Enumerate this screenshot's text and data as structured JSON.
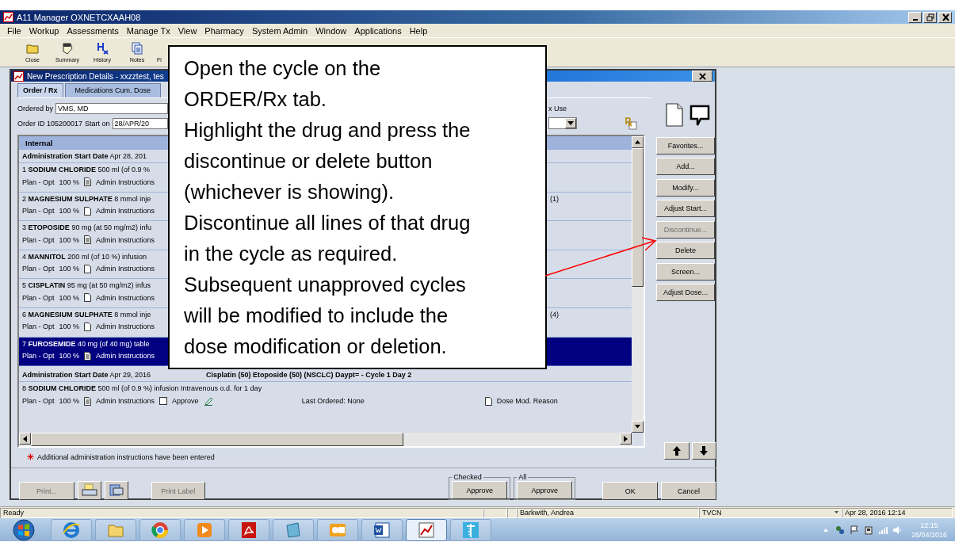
{
  "app": {
    "title": "A11 Manager OXNETCXAAH08"
  },
  "menu": [
    "File",
    "Workup",
    "Assessments",
    "Manage Tx",
    "View",
    "Pharmacy",
    "System Admin",
    "Window",
    "Applications",
    "Help"
  ],
  "toolbar": [
    {
      "label": "Close",
      "kind": "folder"
    },
    {
      "label": "Summary",
      "kind": "note"
    },
    {
      "label": "History",
      "kind": "history"
    },
    {
      "label": "Notes",
      "kind": "pages"
    },
    {
      "label": "Fl",
      "kind": "none"
    }
  ],
  "dialog": {
    "title": "New Prescription Details - xxzztest, tes",
    "tabs": [
      {
        "label": "Order / Rx",
        "selected": true
      },
      {
        "label": "Medications Cum. Dose",
        "selected": false
      }
    ],
    "ordered_by_label": "Ordered by",
    "ordered_by": "VMS,  MD",
    "order_id": "Order ID 105200017",
    "start_on_label": "Start on",
    "start_on": "28/APR/20",
    "use_label": "x Use",
    "list_header": "Internal",
    "groups": [
      {
        "label": "Administration Start Date",
        "date": "Apr 28, 201",
        "rows": [
          {
            "num": "1",
            "name": "SODIUM CHLORIDE",
            "detail": "500 ml (of 0.9 %",
            "plan": "Plan - Opt",
            "percent": "100 %",
            "instructions": true,
            "admin": "Admin Instructions",
            "selected": false
          },
          {
            "num": "2",
            "name": "MAGNESIUM SULPHATE",
            "detail": "8 mmol inje",
            "plan": "Plan - Opt",
            "percent": "100 %",
            "instructions": false,
            "admin": "Admin Instructions",
            "note": "(1)",
            "selected": false
          },
          {
            "num": "3",
            "name": "ETOPOSIDE",
            "detail": "90 mg (at 50 mg/m2) infu",
            "plan": "Plan - Opt",
            "percent": "100 %",
            "instructions": true,
            "admin": "Admin Instructions",
            "selected": false
          },
          {
            "num": "4",
            "name": "MANNITOL",
            "detail": "200 ml (of 10 %) infusion",
            "plan": "Plan - Opt",
            "percent": "100 %",
            "instructions": false,
            "admin": "Admin Instructions",
            "selected": false
          },
          {
            "num": "5",
            "name": "CISPLATIN",
            "detail": "95 mg (at 50 mg/m2) infus",
            "plan": "Plan - Opt",
            "percent": "100 %",
            "instructions": false,
            "admin": "Admin Instructions",
            "selected": false
          },
          {
            "num": "6",
            "name": "MAGNESIUM SULPHATE",
            "detail": "8 mmol inje",
            "plan": "Plan - Opt",
            "percent": "100 %",
            "instructions": false,
            "admin": "Admin Instructions",
            "note": "(4)",
            "selected": false
          },
          {
            "num": "7",
            "name": "FUROSEMIDE",
            "detail": "40 mg (of 40 mg) table",
            "plan": "Plan - Opt",
            "percent": "100 %",
            "instructions": true,
            "admin": "Admin Instructions",
            "selected": true
          }
        ]
      },
      {
        "label": "Administration Start Date",
        "date": "Apr 29, 2016",
        "regimen": "Cisplatin (50) Etoposide (50) (NSCLC) Daypt= - Cycle 1 Day 2",
        "rows": [
          {
            "num": "8",
            "name": "SODIUM CHLORIDE",
            "detail": "500 ml (of 0.9 %) infusion Intravenous o.d. for 1 day",
            "plan": "Plan - Opt",
            "percent": "100 %",
            "instructions": true,
            "admin": "Admin Instructions",
            "selected": false,
            "approve": {
              "label": "Approve",
              "checked": false
            },
            "last_ordered": "Last Ordered: None",
            "dose_mod": "Dose Mod. Reason"
          }
        ]
      }
    ],
    "side_buttons": [
      {
        "label": "Favorites...",
        "disabled": false
      },
      {
        "label": "Add...",
        "disabled": false
      },
      {
        "label": "Modify...",
        "disabled": false
      },
      {
        "label": "Adjust Start...",
        "disabled": false
      },
      {
        "label": "Discontinue...",
        "disabled": true
      },
      {
        "label": "Delete",
        "disabled": false
      },
      {
        "label": "Screen...",
        "disabled": false
      },
      {
        "label": "Adjust Dose...",
        "disabled": false
      }
    ],
    "footnote": "Additional administration instructions have been entered",
    "print": {
      "label": "Print...",
      "disabled": true
    },
    "print_label": {
      "label": "Print Label",
      "disabled": true
    },
    "approve_groups": [
      {
        "legend": "Checked",
        "button": "Approve"
      },
      {
        "legend": "All",
        "button": "Approve"
      }
    ],
    "ok": "OK",
    "cancel": "Cancel"
  },
  "callout": {
    "lines": [
      "Open the cycle on the",
      "ORDER/Rx tab.",
      "Highlight the drug and press the",
      "discontinue or delete button",
      "(whichever is showing).",
      "Discontinue all lines of that drug",
      "in the cycle as required.",
      "Subsequent unapproved cycles",
      "will be modified to include the",
      "dose modification or deletion."
    ]
  },
  "status_bar": {
    "status": "Ready",
    "user": "Barkwith, Andrea",
    "site": "TVCN",
    "datetime": "Apr 28, 2016 12:14"
  },
  "taskbar": {
    "apps": [
      {
        "kind": "browser-e",
        "active": false
      },
      {
        "kind": "folder",
        "active": false
      },
      {
        "kind": "chrome",
        "active": false
      },
      {
        "kind": "media",
        "active": false
      },
      {
        "kind": "pdf",
        "active": false
      },
      {
        "kind": "window",
        "active": false
      },
      {
        "kind": "mail",
        "active": false
      },
      {
        "kind": "word",
        "active": false
      },
      {
        "kind": "chart",
        "active": true
      },
      {
        "kind": "medical",
        "active": false
      }
    ],
    "time": "12:15",
    "date": "28/04/2016"
  }
}
